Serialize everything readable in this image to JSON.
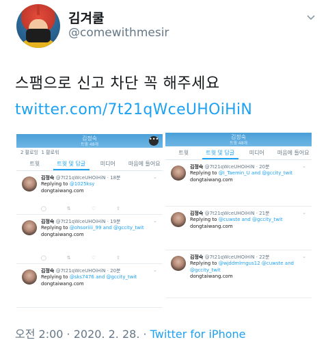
{
  "tweet": {
    "display_name": "김겨쿨",
    "handle": "@comewithmesir",
    "text": "스팸으로 신고 차단 꼭 해주세요",
    "link": "twitter.com/7t21qWceUHOiHiN",
    "timestamp": "오전 2:00 · 2020. 2. 28. · ",
    "source": "Twitter for iPhone"
  },
  "left_shot": {
    "header_title": "김정숙",
    "header_sub": "트윗 48개",
    "followers": "2 팔로잉",
    "following": "1 팔로워",
    "tabs": [
      "트윗",
      "트윗 및 답글",
      "미디어",
      "마음에 들어요"
    ],
    "replies": [
      {
        "name": "김정숙",
        "handle_time": "@7t21qWceUHOiHiN · 18분",
        "replying_label": "Replying to ",
        "mentions": "@1025ksy",
        "tail": "",
        "link": "dongtaiwang.com"
      },
      {
        "name": "김정숙",
        "handle_time": "@7t21qWceUHOiHiN · 19분",
        "replying_label": "Replying to ",
        "mentions": "@ohsoriiii_99 and @gccity_twit",
        "tail": "",
        "link": "dongtaiwang.com"
      },
      {
        "name": "김정숙",
        "handle_time": "@7t21qWceUHOiHiN · 20분",
        "replying_label": "Replying to ",
        "mentions": "@sks7476 and @gccity_twit",
        "tail": "",
        "link": "dongtaiwang.com"
      }
    ]
  },
  "right_shot": {
    "header_title": "김정숙",
    "header_sub": "트윗 48개",
    "tabs": [
      "트윗",
      "트윗 및 답글",
      "미디어",
      "마음에 들어요"
    ],
    "replies": [
      {
        "name": "김정숙",
        "handle_time": "@7t21qWceUHOiHiN · 20분",
        "replying_label": "Replying to ",
        "mentions": "@I_Taemin_U and @gccity_twit",
        "link": "dongtaiwang.com"
      },
      {
        "name": "김정숙",
        "handle_time": "@7t21qWceUHOiHiN · 21분",
        "replying_label": "Replying to ",
        "mentions": "@cuwste and @gccity_twit",
        "link": "dongtaiwang.com"
      },
      {
        "name": "김정숙",
        "handle_time": "@7t21qWceUHOiHiN · 22분",
        "replying_label": "Replying to ",
        "mentions": "@wjddmlrngus12 @cuwste and @gccity_twit",
        "link": "dongtaiwang.com"
      }
    ]
  },
  "action_icons": [
    "reply-icon",
    "retweet-icon",
    "like-icon",
    "share-icon"
  ],
  "colors": {
    "link": "#1da1f2",
    "secondary": "#657786",
    "header": "#4a9fd8"
  }
}
